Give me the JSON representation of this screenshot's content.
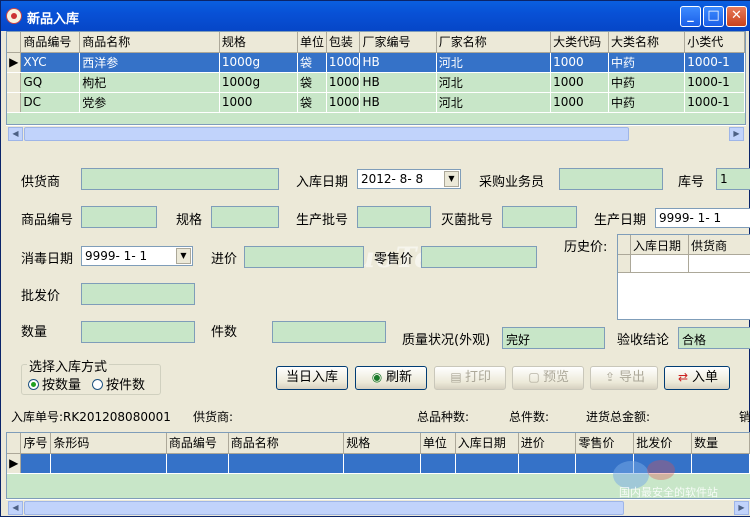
{
  "window": {
    "title": "新品入库"
  },
  "top_grid": {
    "columns": [
      "商品编号",
      "商品名称",
      "规格",
      "单位",
      "包装",
      "厂家编号",
      "厂家名称",
      "大类代码",
      "大类名称",
      "小类代"
    ],
    "rows": [
      [
        "XYC",
        "西洋参",
        "1000g",
        "袋",
        "1000",
        "HB",
        "河北",
        "1000",
        "中药",
        "1000-1"
      ],
      [
        "GQ",
        "枸杞",
        "1000g",
        "袋",
        "1000",
        "HB",
        "河北",
        "1000",
        "中药",
        "1000-1"
      ],
      [
        "DC",
        "党参",
        "1000",
        "袋",
        "1000",
        "HB",
        "河北",
        "1000",
        "中药",
        "1000-1"
      ]
    ]
  },
  "form": {
    "supplier_label": "供货商",
    "supplier_value": "",
    "in_date_label": "入库日期",
    "in_date_value": "2012- 8- 8",
    "purchaser_label": "采购业务员",
    "purchaser_value": "",
    "warehouse_label": "库号",
    "warehouse_value": "1",
    "product_code_label": "商品编号",
    "product_code_value": "",
    "spec_label": "规格",
    "spec_value": "",
    "batch_label": "生产批号",
    "batch_value": "",
    "sterile_batch_label": "灭菌批号",
    "sterile_batch_value": "",
    "prod_date_label": "生产日期",
    "prod_date_value": "9999- 1- 1",
    "disinfect_date_label": "消毒日期",
    "disinfect_date_value": "9999- 1- 1",
    "in_price_label": "进价",
    "in_price_value": "",
    "retail_price_label": "零售价",
    "retail_price_value": "",
    "history_label": "历史价:",
    "history_columns": [
      "入库日期",
      "供货商"
    ],
    "wholesale_label": "批发价",
    "wholesale_value": "",
    "qty_label": "数量",
    "qty_value": "",
    "pieces_label": "件数",
    "pieces_value": "",
    "quality_label": "质量状况(外观)",
    "quality_value": "完好",
    "accept_label": "验收结论",
    "accept_value": "合格"
  },
  "mode_group": {
    "title": "选择入库方式",
    "options": [
      "按数量",
      "按件数"
    ],
    "selected": "按数量"
  },
  "buttons": {
    "today_in": "当日入库",
    "refresh": "刷新",
    "print": "打印",
    "preview": "预览",
    "export": "导出",
    "enter": "入单"
  },
  "status": {
    "order_no": "入库单号:RK201208080001",
    "supplier": "供货商:",
    "total_kinds": "总品种数:",
    "total_pieces": "总件数:",
    "total_amount": "进货总金额:",
    "tail": "销"
  },
  "bottom_grid": {
    "columns": [
      "序号",
      "条形码",
      "商品编号",
      "商品名称",
      "规格",
      "单位",
      "入库日期",
      "进价",
      "零售价",
      "批发价",
      "数量"
    ]
  },
  "watermark": "www.DuoTe.com",
  "badge_text": "国内最安全的软件站"
}
